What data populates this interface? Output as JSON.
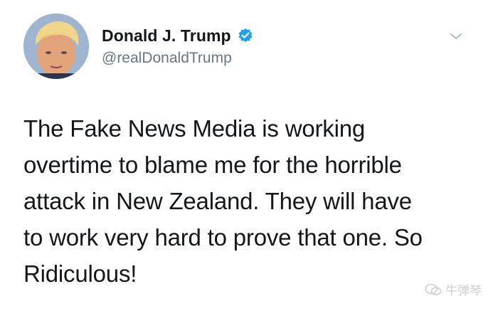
{
  "user": {
    "display_name": "Donald J. Trump",
    "handle": "@realDonaldTrump",
    "verified": true
  },
  "tweet": {
    "text": "The Fake News Media is working\novertime to blame me for the horrible\nattack in New Zealand. They will have\nto work very hard to prove that one. So\nRidiculous!"
  },
  "icons": {
    "verified": "verified-badge-icon",
    "menu": "chevron-down-icon",
    "watermark": "wechat-icon"
  },
  "watermark": {
    "text": "牛弹琴"
  },
  "colors": {
    "verified_blue": "#1da1f2",
    "handle_gray": "#657786",
    "text_dark": "#14171a"
  }
}
